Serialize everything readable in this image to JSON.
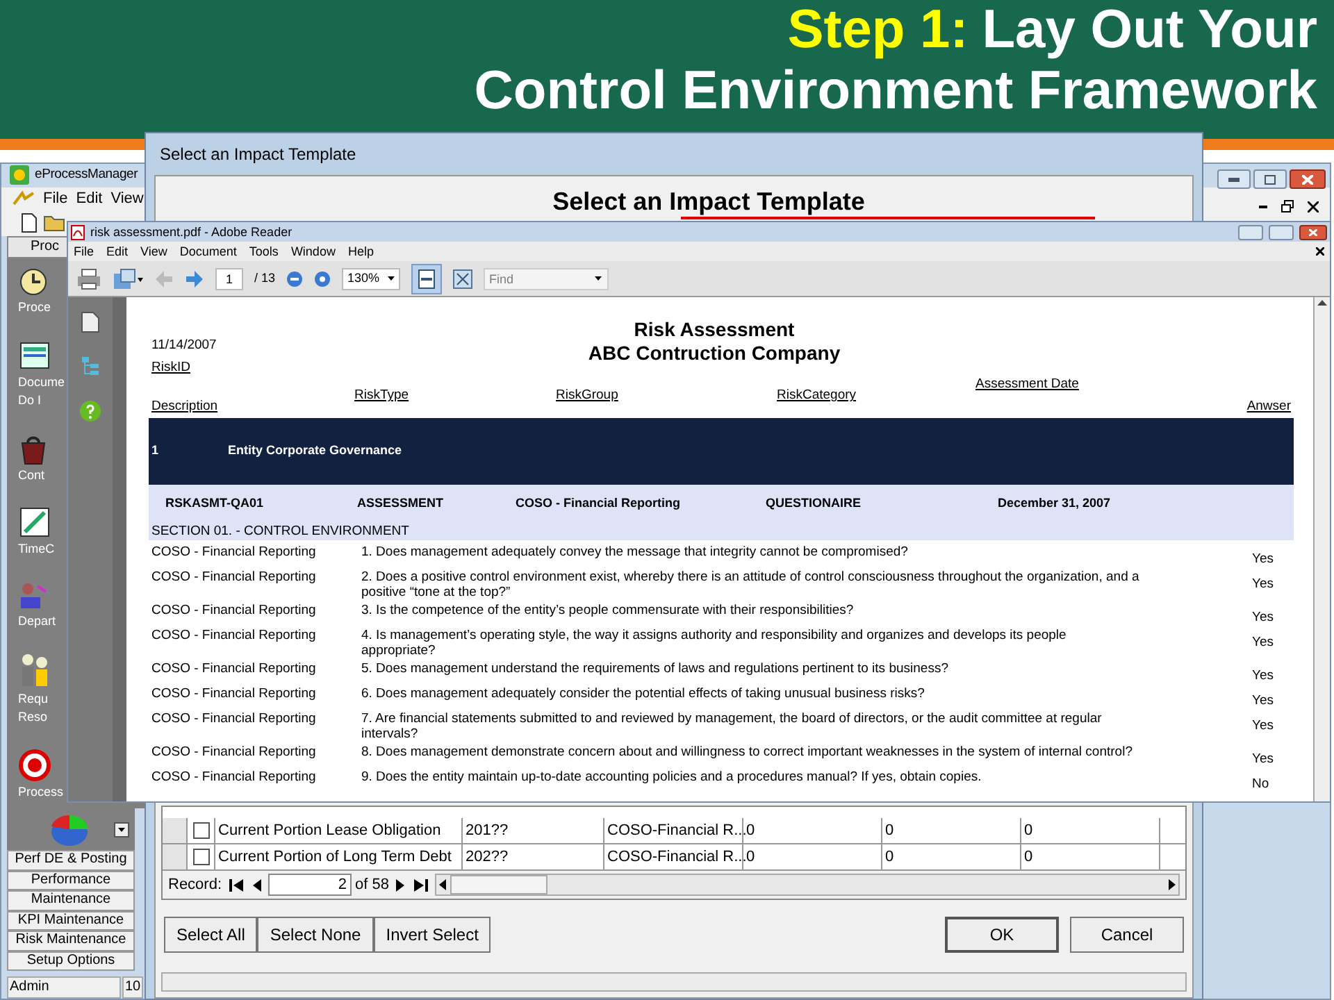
{
  "slide_title": {
    "highlight": "Step 1:",
    "line_1": "Lay Out Your",
    "line_2": "Control Environment Framework"
  },
  "app_window": {
    "title": "eProcessManager",
    "menu": [
      "File",
      "Edit",
      "View"
    ],
    "tab": "Proc",
    "nav_items": [
      {
        "lines": [
          "Proce"
        ]
      },
      {
        "lines": [
          "Docume",
          "Do I"
        ]
      },
      {
        "lines": [
          "Cont"
        ]
      },
      {
        "lines": [
          "TimeC"
        ]
      },
      {
        "lines": [
          "Depart"
        ]
      },
      {
        "lines": [
          "Requ",
          "Reso"
        ]
      },
      {
        "lines": [
          "Process"
        ]
      }
    ],
    "modules": [
      "Perf DE & Posting",
      "Performance",
      "Maintenance",
      "KPI Maintenance",
      "Risk Maintenance",
      "Setup Options"
    ],
    "status": [
      "Admin",
      "10"
    ]
  },
  "dialog": {
    "title": "Select an Impact Template",
    "heading": "Select an Impact Template",
    "rows": [
      {
        "checked": false,
        "cells": [
          "Current Portion Lease Obligation",
          "201??",
          "COSO-Financial R...",
          "0",
          "0",
          "0"
        ]
      },
      {
        "checked": false,
        "cells": [
          "Current Portion of Long Term Debt",
          "202??",
          "COSO-Financial R...",
          "0",
          "0",
          "0"
        ]
      }
    ],
    "record": {
      "label": "Record:",
      "value": "2",
      "total": "of 58"
    },
    "left_buttons": [
      "Select All",
      "Select None",
      "Invert Select"
    ],
    "ok": "OK",
    "cancel": "Cancel"
  },
  "reader": {
    "title": "risk assessment.pdf - Adobe Reader",
    "menu": [
      "File",
      "Edit",
      "View",
      "Document",
      "Tools",
      "Window",
      "Help"
    ],
    "page": "1",
    "pages": "/ 13",
    "zoom": "130%",
    "find_placeholder": "Find",
    "document": {
      "date": "11/14/2007",
      "title": "Risk Assessment",
      "subtitle": "ABC Contruction Company",
      "headers": {
        "risk_id": "RiskID",
        "risk_type": "RiskType",
        "risk_group": "RiskGroup",
        "risk_category": "RiskCategory",
        "assessment_date": "Assessment Date",
        "description": "Description",
        "answer": "Anwser"
      },
      "group": {
        "number": "1",
        "name": "Entity Corporate Governance"
      },
      "record": [
        "RSKASMT-QA01",
        "ASSESSMENT",
        "COSO - Financial Reporting",
        "QUESTIONAIRE",
        "December 31, 2007"
      ],
      "section": "SECTION 01. - CONTROL ENVIRONMENT",
      "questions": [
        {
          "group": "COSO - Financial Reporting",
          "text": "1. Does management adequately convey the message that integrity cannot be compromised?",
          "answer": "Yes"
        },
        {
          "group": "COSO - Financial Reporting",
          "text": "2. Does a positive control environment exist, whereby there is an attitude of control consciousness throughout the organization, and a positive “tone at the top?”",
          "answer": "Yes"
        },
        {
          "group": "COSO - Financial Reporting",
          "text": "3. Is the competence of the entity’s people commensurate with their responsibilities?",
          "answer": "Yes"
        },
        {
          "group": "COSO - Financial Reporting",
          "text": "4. Is management’s operating style, the way it assigns authority and responsibility and organizes and develops its people appropriate?",
          "answer": "Yes"
        },
        {
          "group": "COSO - Financial Reporting",
          "text": "5. Does management understand the requirements of laws and regulations pertinent to its business?",
          "answer": "Yes"
        },
        {
          "group": "COSO - Financial Reporting",
          "text": "6. Does management adequately consider the potential effects of taking unusual business risks?",
          "answer": "Yes"
        },
        {
          "group": "COSO - Financial Reporting",
          "text": "7. Are financial statements submitted to and reviewed by management, the board of directors, or the audit committee at regular intervals?",
          "answer": "Yes"
        },
        {
          "group": "COSO - Financial Reporting",
          "text": "8. Does management demonstrate concern about and willingness to correct important weaknesses in the system of internal control?",
          "answer": "Yes"
        },
        {
          "group": "COSO - Financial Reporting",
          "text": "9. Does the entity maintain up-to-date accounting policies and a procedures manual? If yes, obtain copies.",
          "answer": "No"
        }
      ]
    }
  }
}
